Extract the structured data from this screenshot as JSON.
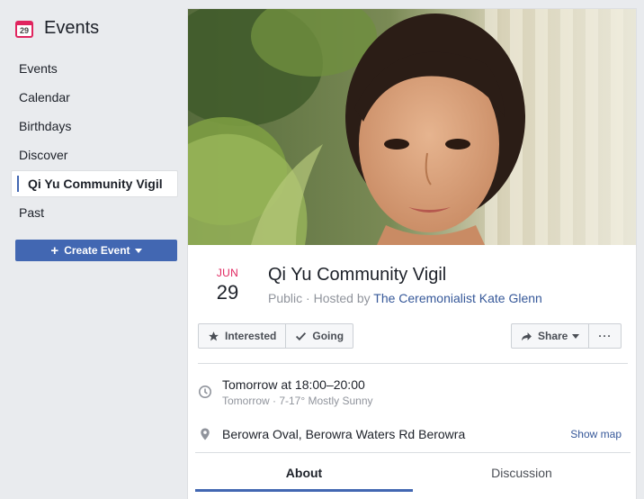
{
  "sidebar": {
    "title": "Events",
    "calendar_icon_day": "29",
    "items": [
      {
        "label": "Events"
      },
      {
        "label": "Calendar"
      },
      {
        "label": "Birthdays"
      },
      {
        "label": "Discover"
      },
      {
        "label": "Qi Yu Community Vigil",
        "active": true
      },
      {
        "label": "Past"
      }
    ],
    "create_button": {
      "plus": "+",
      "label": "Create Event"
    }
  },
  "event": {
    "date": {
      "month": "JUN",
      "day": "29"
    },
    "title": "Qi Yu Community Vigil",
    "privacy": "Public",
    "hosted_prefix": " · Hosted by ",
    "host": "The Ceremonialist Kate Glenn",
    "actions": {
      "interested": "Interested",
      "going": "Going",
      "share": "Share",
      "more": "···"
    },
    "when": {
      "main": "Tomorrow at 18:00–20:00",
      "sub": "Tomorrow · 7-17° Mostly Sunny"
    },
    "where": {
      "place": "Berowra Oval, Berowra Waters Rd Berowra",
      "show_map": "Show map"
    }
  },
  "tabs": [
    {
      "label": "About",
      "active": true
    },
    {
      "label": "Discussion"
    }
  ],
  "colors": {
    "accent": "#4267b2",
    "date_month": "#e0245e",
    "link": "#365899"
  }
}
